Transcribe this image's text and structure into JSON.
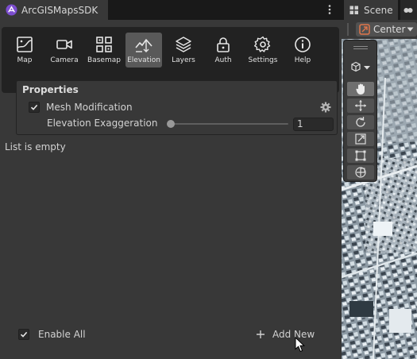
{
  "left_panel": {
    "tab_title": "ArcGISMapsSDK",
    "toolbar": [
      {
        "label": "Map",
        "icon": "map-icon",
        "active": false
      },
      {
        "label": "Camera",
        "icon": "camera-icon",
        "active": false
      },
      {
        "label": "Basemap",
        "icon": "basemap-icon",
        "active": false
      },
      {
        "label": "Elevation",
        "icon": "elevation-icon",
        "active": true
      },
      {
        "label": "Layers",
        "icon": "layers-icon",
        "active": false
      },
      {
        "label": "Auth",
        "icon": "lock-icon",
        "active": false
      },
      {
        "label": "Settings",
        "icon": "gear-icon",
        "active": false
      },
      {
        "label": "Help",
        "icon": "help-icon",
        "active": false
      }
    ],
    "properties": {
      "title": "Properties",
      "mesh_modification": {
        "label": "Mesh Modification",
        "checked": true
      },
      "elevation_exaggeration": {
        "label": "Elevation Exaggeration",
        "value": "1",
        "slider_fraction": 0.0
      }
    },
    "list_empty_text": "List is empty",
    "enable_all": {
      "label": "Enable All",
      "checked": true
    },
    "add_new_label": "Add New"
  },
  "scene_panel": {
    "tab_title": "Scene",
    "pivot_label": "Center",
    "tools": [
      "hand-icon",
      "move-icon",
      "rotate-icon",
      "scale-icon",
      "rect-icon",
      "transform-icon"
    ],
    "active_tool": "hand-icon"
  },
  "colors": {
    "panel_bg": "#383838",
    "toolbar_bg": "#222222",
    "active_tool_bg": "#595959",
    "sdk_logo": "#7c4dcf"
  }
}
